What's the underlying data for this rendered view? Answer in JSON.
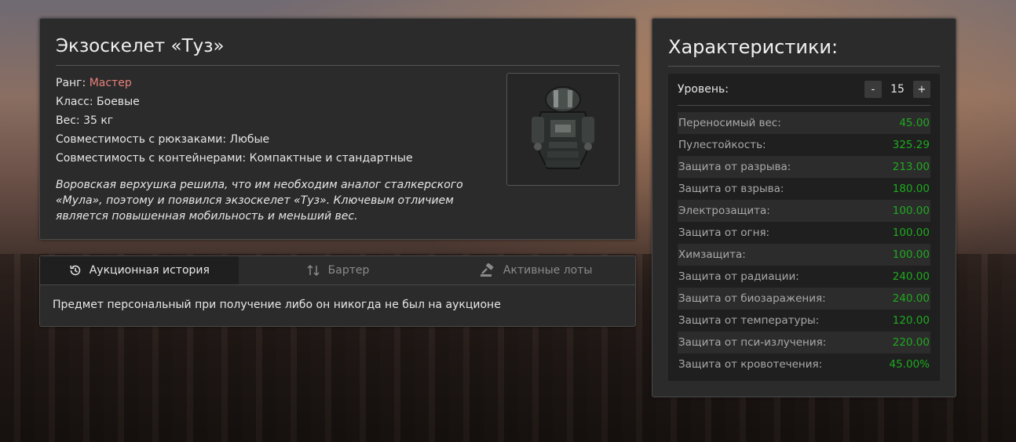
{
  "item": {
    "title": "Экзоскелет «Туз»",
    "rank_label": "Ранг: ",
    "rank_value": "Мастер",
    "class_line": "Класс: Боевые",
    "weight_line": "Вес: 35 кг",
    "backpack_line": "Совместимость с рюкзаками: Любые",
    "container_line": "Совместимость с контейнерами: Компактные и стандартные",
    "description": "Воровская верхушка решила, что им необходим аналог сталкерского «Мула», поэтому и появился экзоскелет «Туз». Ключевым отличием является повышенная мобильность и меньший вес.",
    "image_icon": "exoskeleton-armor-icon"
  },
  "tabs": [
    {
      "label": "Аукционная история",
      "icon": "history-icon",
      "active": true
    },
    {
      "label": "Бартер",
      "icon": "swap-arrows-icon",
      "active": false
    },
    {
      "label": "Активные лоты",
      "icon": "auction-gavel-icon",
      "active": false
    }
  ],
  "tab_content": "Предмет персональный при получение либо он никогда не был на аукционе",
  "stats": {
    "title": "Характеристики:",
    "level_label": "Уровень:",
    "level_value": "15",
    "minus": "-",
    "plus": "+",
    "rows": [
      {
        "label": "Переносимый вес:",
        "value": "45.00"
      },
      {
        "label": "Пулестойкость:",
        "value": "325.29"
      },
      {
        "label": "Защита от разрыва:",
        "value": "213.00"
      },
      {
        "label": "Защита от взрыва:",
        "value": "180.00"
      },
      {
        "label": "Электрозащита:",
        "value": "100.00"
      },
      {
        "label": "Защита от огня:",
        "value": "100.00"
      },
      {
        "label": "Химзащита:",
        "value": "100.00"
      },
      {
        "label": "Защита от радиации:",
        "value": "240.00"
      },
      {
        "label": "Защита от биозаражения:",
        "value": "240.00"
      },
      {
        "label": "Защита от температуры:",
        "value": "120.00"
      },
      {
        "label": "Защита от пси-излучения:",
        "value": "220.00"
      },
      {
        "label": "Защита от кровотечения:",
        "value": "45.00%"
      }
    ]
  },
  "colors": {
    "rank": "#e8807a",
    "stat_value": "#1faa1f",
    "panel_bg": "#2b2b2b"
  }
}
